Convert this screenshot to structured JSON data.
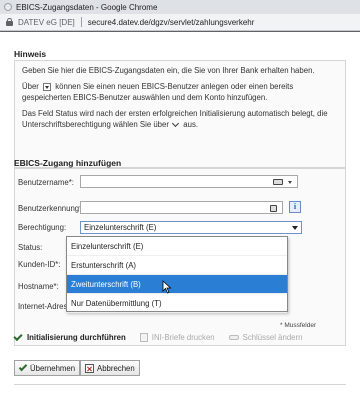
{
  "window": {
    "title": "EBICS-Zugangsdaten - Google Chrome"
  },
  "urlbar": {
    "origin": "DATEV eG [DE]",
    "url": "secure4.datev.de/dgzv/servlet/zahlungsverkehr"
  },
  "hint": {
    "title": "Hinweis",
    "line1": "Geben Sie hier die EBICS-Zugangsdaten ein, die Sie von Ihrer Bank erhalten haben.",
    "line2_pre": "Über",
    "line2_post": "können Sie einen neuen EBICS-Benutzer anlegen oder einen bereits gespeicherten EBICS-Benutzer auswählen und dem Konto hinzufügen.",
    "line3_pre": "Das Feld Status wird nach der ersten erfolgreichen Initialisierung automatisch belegt, die Unterschriftsberechtigung wählen Sie über",
    "line3_post": "aus."
  },
  "form": {
    "title": "EBICS-Zugang hinzufügen",
    "benutzername_label": "Benutzername*:",
    "benutzername_value": "",
    "benutzerkennung_label": "Benutzerkennung*:",
    "benutzerkennung_value": "",
    "berechtigung_label": "Berechtigung:",
    "berechtigung_value": "Einzelunterschrift (E)",
    "status_label": "Status:",
    "kunden_id_label": "Kunden-ID*:",
    "hostname_label": "Hostname*:",
    "internet_adresse_label": "Internet-Adresse:",
    "required_note": "* Mussfelder"
  },
  "dropdown": {
    "options": [
      {
        "label": "Einzelunterschrift (E)",
        "selected": false
      },
      {
        "label": "Erstunterschrift (A)",
        "selected": false
      },
      {
        "label": "Zweitunterschrift (B)",
        "selected": true
      },
      {
        "label": "Nur Datenübermittlung (T)",
        "selected": false
      }
    ]
  },
  "actions": {
    "init": "Initialisierung durchführen",
    "ini_briefe": "INI-Briefe drucken",
    "schluessel": "Schlüssel ändern"
  },
  "buttons": {
    "ok": "Übernehmen",
    "cancel": "Abbrechen"
  },
  "colors": {
    "selection": "#2a7fd4",
    "focus_border": "#6f93c8"
  },
  "icons": {
    "lock": "lock-icon",
    "info": "info-icon",
    "key": "key-icon",
    "check": "check-icon",
    "cancel": "cancel-icon"
  }
}
